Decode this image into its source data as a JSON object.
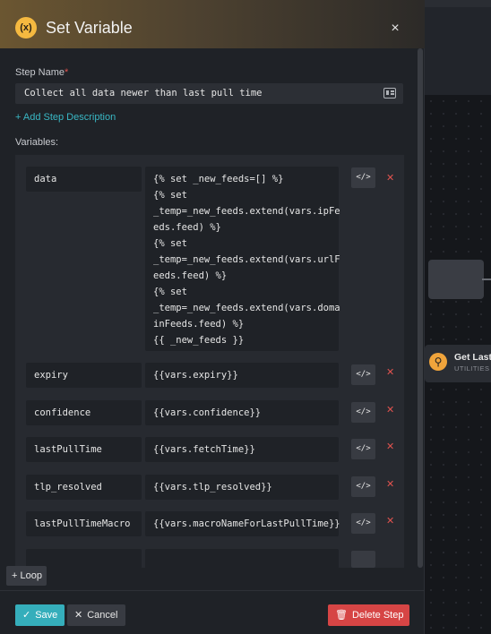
{
  "canvas": {
    "node_title": "Get Last",
    "node_subtitle": "UTILITIES"
  },
  "header": {
    "icon_text": "(x)",
    "title": "Set Variable",
    "close_glyph": "×"
  },
  "form": {
    "step_name_label": "Step Name",
    "required_mark": "*",
    "step_name_value": "Collect all data newer than last pull time",
    "add_description_label": "+ Add Step Description",
    "variables_label": "Variables:"
  },
  "variables": [
    {
      "name": "data",
      "value_lines": [
        "{% set _new_feeds=[] %}",
        "{% set",
        "_temp=_new_feeds.extend(vars.ipFe",
        "eds.feed) %}",
        "{% set",
        "_temp=_new_feeds.extend(vars.urlF",
        "eeds.feed) %}",
        "{% set",
        "_temp=_new_feeds.extend(vars.doma",
        "inFeeds.feed) %}",
        "{{ _new_feeds }}"
      ]
    },
    {
      "name": "expiry",
      "value_lines": [
        "{{vars.expiry}}"
      ]
    },
    {
      "name": "confidence",
      "value_lines": [
        "{{vars.confidence}}"
      ]
    },
    {
      "name": "lastPullTime",
      "value_lines": [
        "{{vars.fetchTime}}"
      ]
    },
    {
      "name": "tlp_resolved",
      "value_lines": [
        "{{vars.tlp_resolved}}"
      ]
    },
    {
      "name": "lastPullTimeMacro",
      "value_lines": [
        "{{vars.macroNameForLastPullTime}}"
      ]
    }
  ],
  "row_controls": {
    "code_glyph": "</>",
    "remove_glyph": "✕"
  },
  "footer": {
    "loop_label": "+ Loop",
    "save_label": "Save",
    "cancel_label": "Cancel",
    "delete_label": "Delete Step"
  },
  "colors": {
    "accent": "#35aebb",
    "danger": "#d64545",
    "header_icon": "#f5b940"
  }
}
